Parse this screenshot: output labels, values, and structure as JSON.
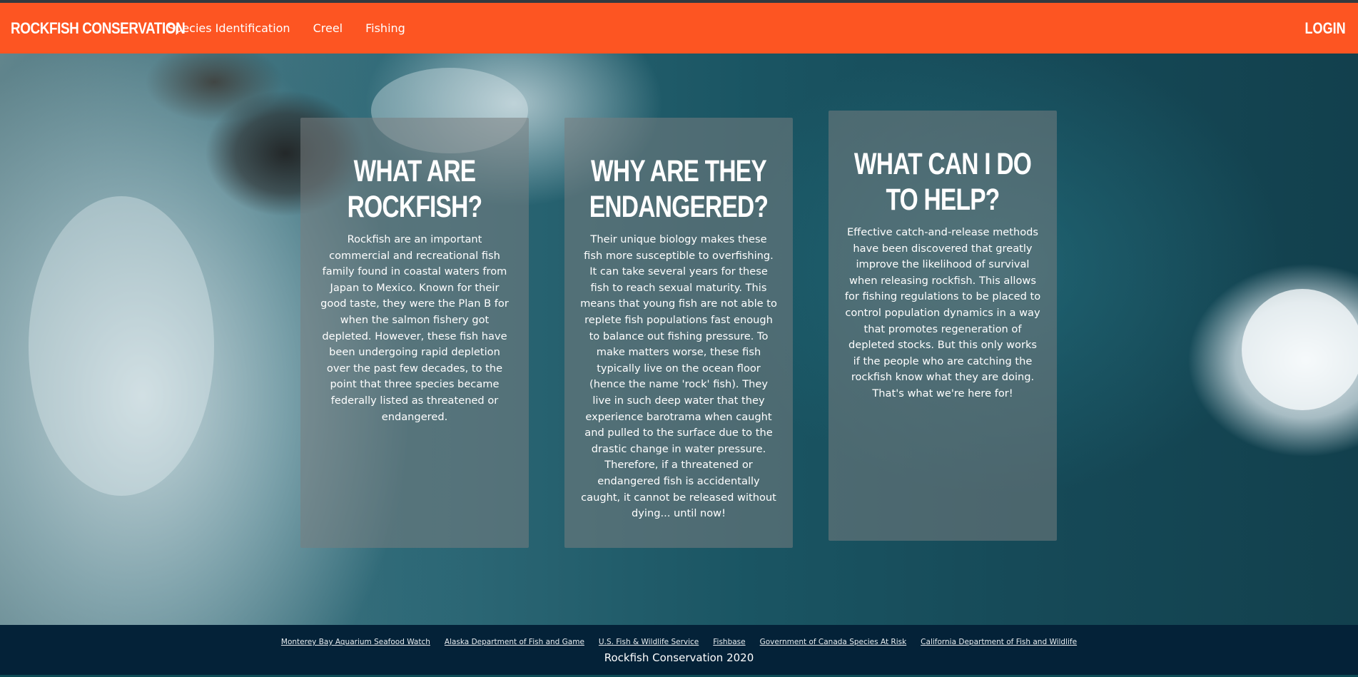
{
  "navbar": {
    "brand": "ROCKFISH CONSERVATION",
    "links": [
      "Species Identification",
      "Creel",
      "Fishing"
    ],
    "login": "LOGIN",
    "color": "#fd5522"
  },
  "cards": [
    {
      "title": "WHAT ARE ROCKFISH?",
      "body": "Rockfish are an important commercial and recreational fish family found in coastal waters from Japan to Mexico. Known for their good taste, they were the Plan B for when the salmon fishery got depleted. However, these fish have been undergoing rapid depletion over the past few decades, to the point that three species became federally listed as threatened or endangered."
    },
    {
      "title": "WHY ARE THEY ENDANGERED?",
      "body": "Their unique biology makes these fish more susceptible to overfishing. It can take several years for these fish to reach sexual maturity. This means that young fish are not able to replete fish populations fast enough to balance out fishing pressure. To make matters worse, these fish typically live on the ocean floor (hence the name 'rock' fish). They live in such deep water that they experience barotrama when caught and pulled to the surface due to the drastic change in water pressure. Therefore, if a threatened or endangered fish is accidentally caught, it cannot be released without dying... until now!"
    },
    {
      "title": "WHAT CAN I DO TO HELP?",
      "body": "Effective catch-and-release methods have been discovered that greatly improve the likelihood of survival when releasing rockfish. This allows for fishing regulations to be placed to control population dynamics in a way that promotes regeneration of depleted stocks. But this only works if the people who are catching the rockfish know what they are doing. That's what we're here for!"
    }
  ],
  "footer": {
    "links": [
      "Monterey Bay Aquarium Seafood Watch",
      "Alaska Department of Fish and Game",
      "U.S. Fish & Wildlife Service",
      "Fishbase",
      "Government of Canada Species At Risk",
      "California Department of Fish and Wildlife"
    ],
    "copyright": "Rockfish Conservation 2020",
    "color": "#042238"
  }
}
